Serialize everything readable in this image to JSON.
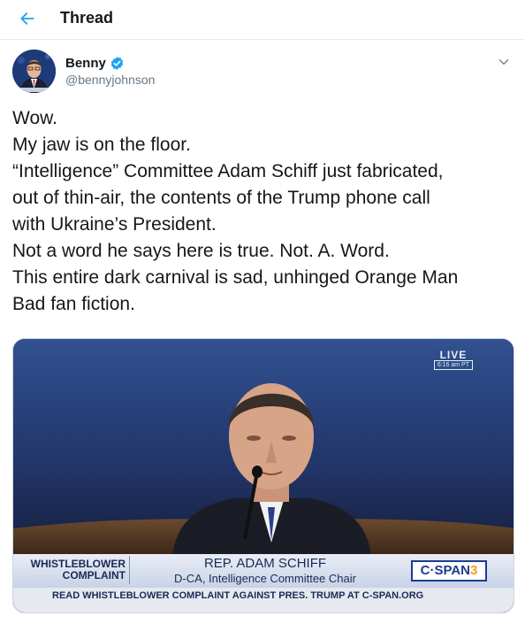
{
  "header": {
    "title": "Thread",
    "back_icon": "arrow-left-icon",
    "accent": "#1da1f2"
  },
  "tweet": {
    "author_name": "Benny",
    "handle": "@bennyjohnson",
    "verified": true,
    "verified_color": "#1da1f2",
    "lines": [
      "Wow.",
      "My jaw is on the floor.",
      "“Intelligence” Committee Adam Schiff just fabricated,",
      "out of thin-air, the contents of the Trump phone call",
      "with Ukraine’s President.",
      "Not a word he says here is true. Not. A. Word.",
      "This entire dark carnival is sad, unhinged Orange Man",
      "Bad fan fiction."
    ]
  },
  "media": {
    "live_label": "LIVE",
    "live_time": "6:16 am PT",
    "chyron_left": [
      "WHISTLEBLOWER",
      "COMPLAINT"
    ],
    "chyron_name": "REP. ADAM SCHIFF",
    "chyron_title": "D-CA, Intelligence Committee Chair",
    "network_prefix": "C·SPAN",
    "network_number": "3",
    "ticker": "READ WHISTLEBLOWER COMPLAINT AGAINST PRES. TRUMP AT C-SPAN.ORG"
  }
}
